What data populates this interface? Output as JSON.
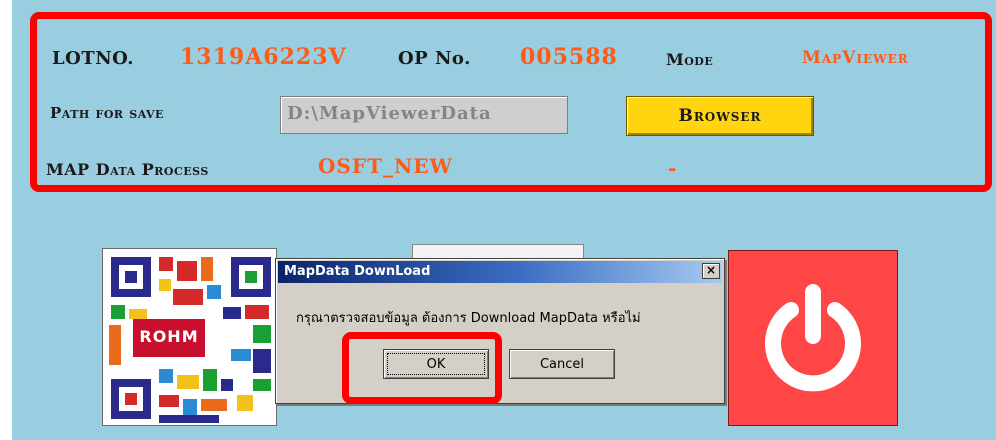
{
  "header": {
    "lot_label": "LOTNO.",
    "lot_value": "1319A6223V",
    "op_label": "OP No.",
    "op_value": "005588",
    "mode_label": "Mode",
    "mode_value": "MapViewer"
  },
  "save": {
    "label": "Path for save",
    "path_value": "D:\\MapViewerData",
    "browse_label": "Browser"
  },
  "process": {
    "label": "MAP Data Process",
    "value": "OSFT_NEW",
    "extra": "-"
  },
  "tiles": {
    "logo_text": "ROHM"
  },
  "dialog": {
    "title": "MapData DownLoad",
    "close_glyph": "×",
    "message": "กรุณาตรวจสอบข้อมูล  ต้องการ Download MapData หรือไม่",
    "ok_label": "OK",
    "cancel_label": "Cancel"
  },
  "colors": {
    "background": "#99cde0",
    "highlight": "#ff0000",
    "value_text": "#ff5a17",
    "browse_button": "#ffd50f",
    "power_tile": "#ff4646"
  }
}
